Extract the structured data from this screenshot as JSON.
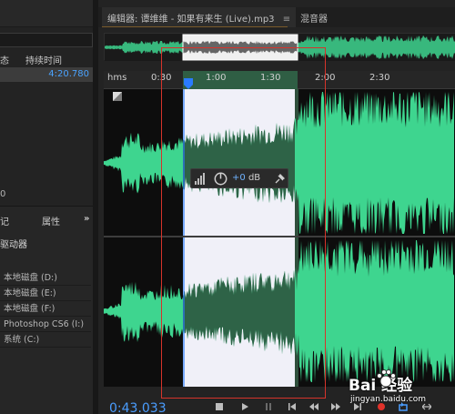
{
  "left_panel": {
    "col_status": "态",
    "col_duration": "持续时间",
    "file_duration": "4:20.780",
    "zero_label": "0",
    "tabs": {
      "markers": "记",
      "properties": "属性",
      "more": "»"
    },
    "section_title": "驱动器",
    "drives": [
      "本地磁盘 (D:)",
      "本地磁盘 (E:)",
      "本地磁盘 (F:)",
      "Photoshop CS6 (I:)",
      "系统 (C:)"
    ]
  },
  "editor": {
    "tab_label": "编辑器: 谭维维 - 如果有来生 (Live).mp3",
    "tab_menu": "≡",
    "mixer_tab": "混音器",
    "ruler": {
      "unit": "hms",
      "ticks": [
        {
          "label": "0:30"
        },
        {
          "label": "1:00"
        },
        {
          "label": "1:30"
        },
        {
          "label": "2:00"
        },
        {
          "label": "2:30"
        }
      ]
    },
    "hud": {
      "value": "+0",
      "unit": "dB"
    },
    "timecode": "0:43.033"
  },
  "colors": {
    "waveform": "#3ed58f",
    "selection": "#f0f0f8",
    "playhead": "#2a7bff",
    "annotation": "#d6332b"
  },
  "watermark": {
    "brand": "Bai 经验",
    "url": "jingyan.baidu.com"
  }
}
